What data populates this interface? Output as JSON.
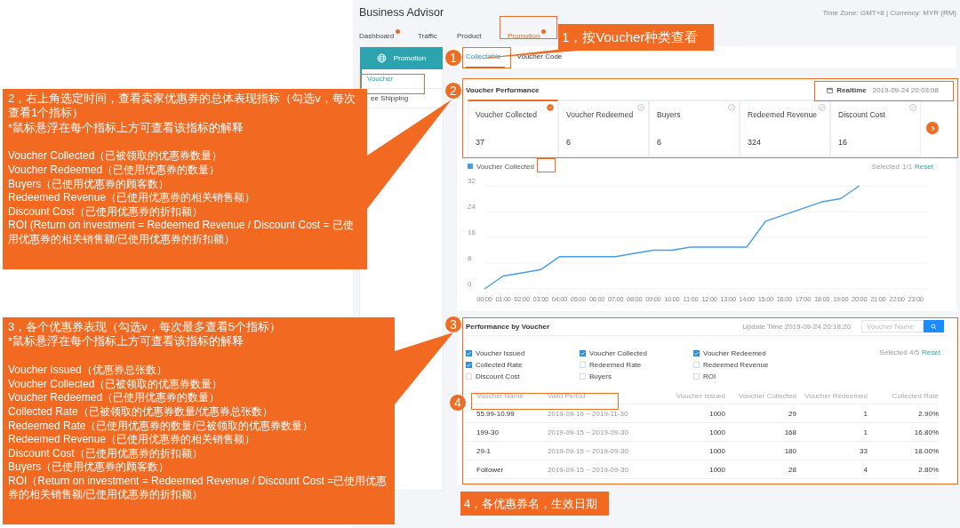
{
  "app": {
    "title": "Business Advisor",
    "meta": "Time Zone: GMT+8 | Currency: MYR (RM)"
  },
  "nav_tabs": [
    {
      "label": "Dashboard",
      "selected": false,
      "dot": true
    },
    {
      "label": "Traffic",
      "selected": false,
      "dot": false
    },
    {
      "label": "Product",
      "selected": false,
      "dot": false
    },
    {
      "label": "Promotion",
      "selected": true,
      "dot": true
    }
  ],
  "sidebar": {
    "header": "Promotion",
    "items": [
      {
        "label": "Voucher",
        "selected": true
      },
      {
        "label": "ee Shipping",
        "selected": false
      }
    ]
  },
  "voucher_tabs": [
    {
      "label": "Collectable",
      "selected": true
    },
    {
      "label": "Voucher Code",
      "selected": false
    }
  ],
  "voucher_performance": {
    "title": "Voucher Performance",
    "time_label": "Realtime",
    "time": "2019-09-24 20:03:08",
    "metrics": [
      {
        "label": "Voucher Collected",
        "value": "37",
        "selected": true
      },
      {
        "label": "Voucher Redeemed",
        "value": "6",
        "selected": false
      },
      {
        "label": "Buyers",
        "value": "6",
        "selected": false
      },
      {
        "label": "Redeemed Revenue",
        "value": "324",
        "selected": false
      },
      {
        "label": "Discount Cost",
        "value": "16",
        "selected": false
      }
    ],
    "selected_label": "Selected",
    "selected_count": "1/1",
    "reset": "Reset",
    "chart_data": {
      "type": "line",
      "categories": [
        "00:00",
        "01:00",
        "02:00",
        "03:00",
        "04:00",
        "05:00",
        "06:00",
        "07:00",
        "08:00",
        "09:00",
        "10:00",
        "11:00",
        "12:00",
        "13:00",
        "14:00",
        "15:00",
        "16:00",
        "17:00",
        "18:00",
        "19:00",
        "20:00",
        "21:00",
        "22:00",
        "23:00"
      ],
      "series": [
        {
          "name": "Voucher Collected",
          "color": "#4a9de2",
          "values": [
            0,
            4,
            5,
            6,
            10,
            10,
            10,
            10,
            11,
            12,
            12,
            13,
            13,
            13,
            13,
            21,
            23,
            25,
            27,
            28,
            32,
            null,
            null,
            null
          ]
        }
      ],
      "ylim": [
        0,
        32
      ],
      "yticks": [
        0,
        8,
        16,
        24,
        32
      ],
      "grid": true
    }
  },
  "performance_by_voucher": {
    "title": "Performance by Voucher",
    "update_time": "Update Time 2019-09-24 20:18:20",
    "search": {
      "placeholder": "Voucher Name"
    },
    "options": [
      {
        "label": "Voucher Issued",
        "checked": true
      },
      {
        "label": "Voucher Collected",
        "checked": true
      },
      {
        "label": "Voucher Redeemed",
        "checked": true
      },
      {
        "label": "Collected Rate",
        "checked": true
      },
      {
        "label": "Redeemed Rate",
        "checked": false
      },
      {
        "label": "Redeemed Revenue",
        "checked": false
      },
      {
        "label": "Discount Cost",
        "checked": false
      },
      {
        "label": "Buyers",
        "checked": false
      },
      {
        "label": "ROI",
        "checked": false
      }
    ],
    "selected_text": "Selected 4/5",
    "reset": "Reset",
    "table": {
      "columns": [
        "Voucher Name",
        "Valid Period",
        "Voucher Issued",
        "Voucher Collected",
        "Voucher Redeemed",
        "Collected Rate"
      ],
      "rows": [
        [
          "55.99-10.99",
          "2019-09-16 ~ 2019-11-30",
          "1000",
          "29",
          "1",
          "2.90%"
        ],
        [
          "199-30",
          "2019-09-15 ~ 2019-09-30",
          "1000",
          "168",
          "1",
          "16.80%"
        ],
        [
          "29-1",
          "2019-09-15 ~ 2019-09-30",
          "1000",
          "180",
          "33",
          "18.00%"
        ],
        [
          "Follower",
          "2019-09-15 ~ 2019-09-30",
          "1000",
          "28",
          "4",
          "2.80%"
        ]
      ]
    }
  },
  "badges": [
    "1",
    "2",
    "3",
    "4"
  ],
  "callouts": [
    {
      "kind": "label",
      "text": "1，按Voucher种类查看"
    },
    {
      "kind": "panel",
      "heading": "2，右上角选定时间，查看卖家优惠券的总体表现指标（勾选v，每次查看1个指标）",
      "note": "*鼠标悬浮在每个指标上方可查看该指标的解释",
      "items": [
        "Voucher Collected（已被领取的优惠券数量）",
        "Voucher Redeemed（已使用优惠券的数量）",
        "Buyers（已使用优惠券的顾客数）",
        "Redeemed Revenue（已使用优惠券的相关销售额）",
        "Discount Cost（已使用优惠券的折扣额）",
        "ROI (Return on investment = Redeemed Revenue / Discount Cost = 已使用优惠券的相关销售额/已使用优惠券的折扣额）"
      ]
    },
    {
      "kind": "panel",
      "heading": "3，各个优惠券表现（勾选v，每次最多查看5个指标）",
      "note": "*鼠标悬浮在每个指标上方可查看该指标的解释",
      "items": [
        "Voucher Issued（优惠券总张数）",
        "Voucher Collected（已被领取的优惠券数量）",
        "Voucher Redeemed（已使用优惠券的数量）",
        "Collected Rate（已被领取的优惠券数量/优惠券总张数）",
        "Redeemed Rate（已使用优惠券的数量/已被领取的优惠券数量）",
        "Redeemed Revenue（已使用优惠券的相关销售额）",
        "Discount Cost（已使用优惠券的折扣额）",
        "Buyers（已使用优惠券的顾客数）",
        "ROI（Return on investment = Redeemed Revenue / Discount Cost =已使用优惠券的相关销售额/已使用优惠券的折扣额）"
      ]
    },
    {
      "kind": "label",
      "text": "4，各优惠券名，生效日期"
    }
  ]
}
